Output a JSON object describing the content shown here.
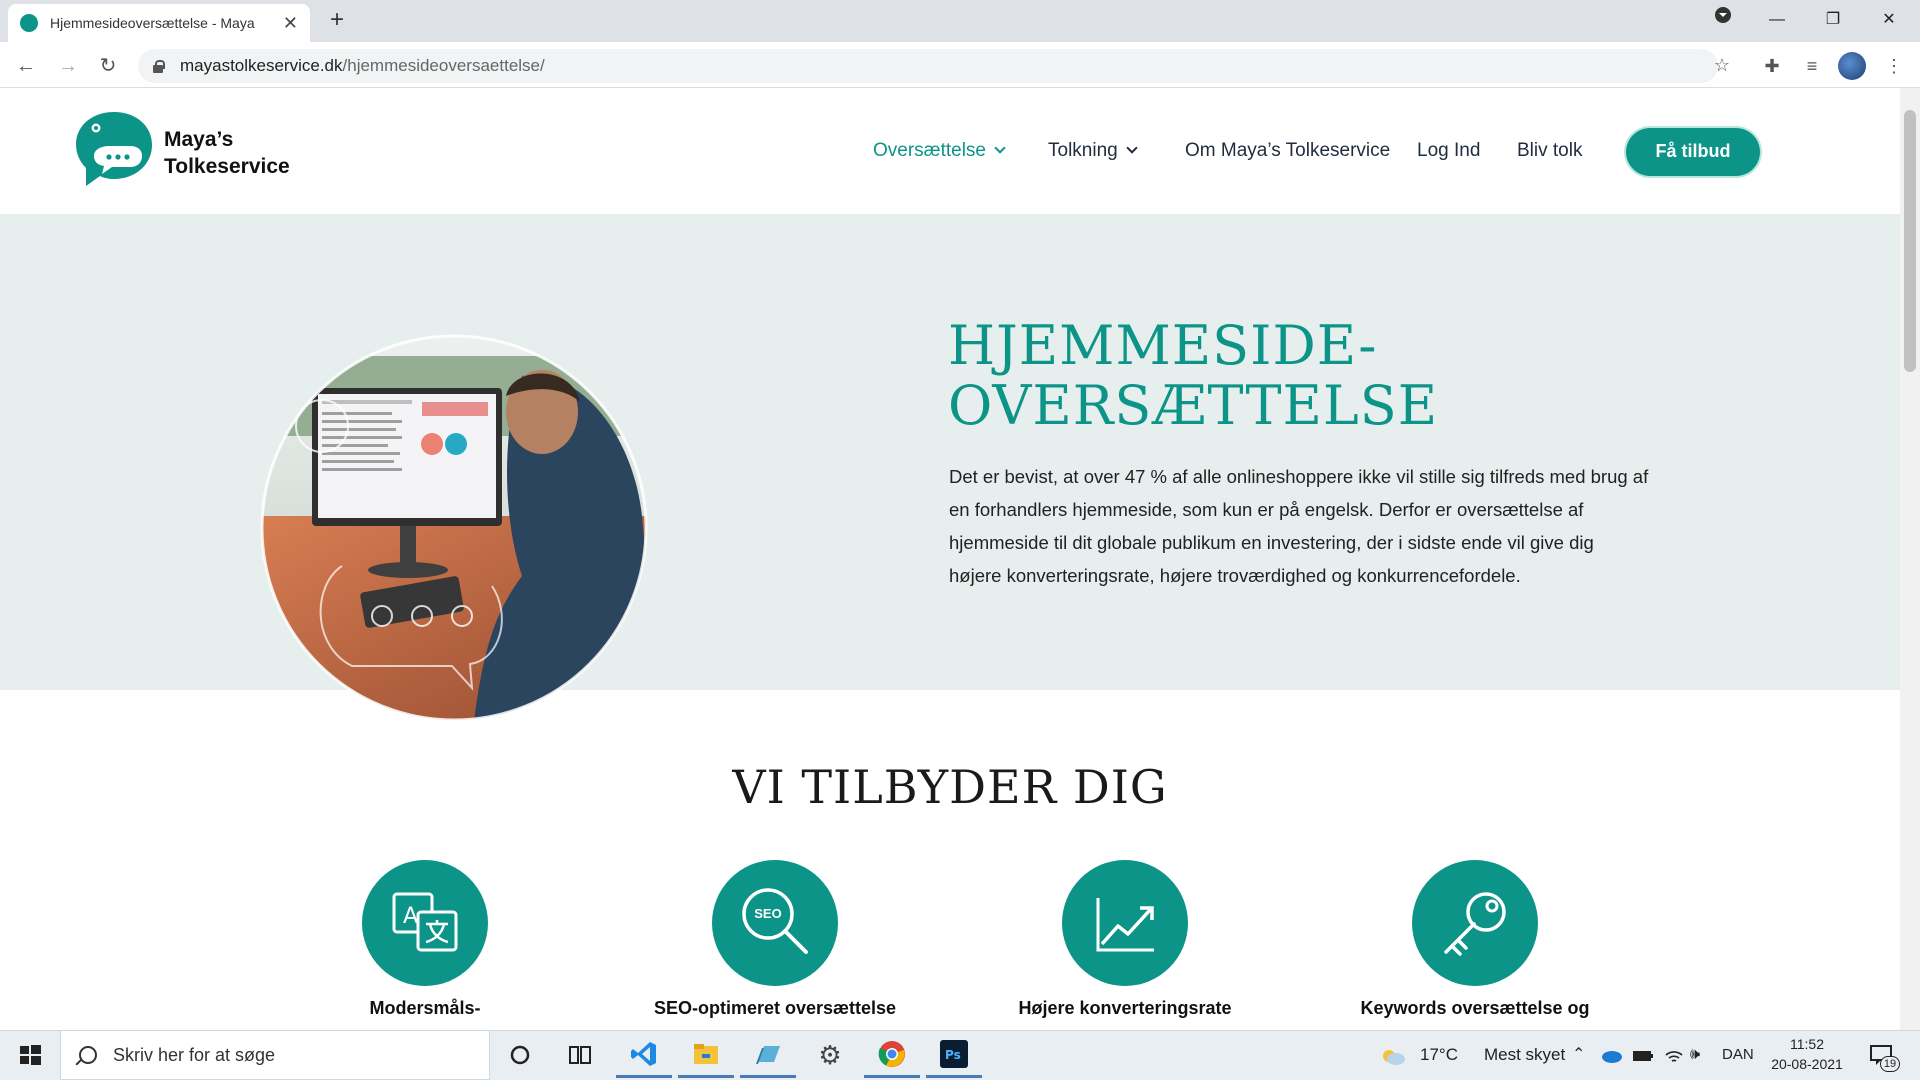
{
  "browser": {
    "tab_title": "Hjemmesideoversættelse - Maya",
    "new_tab_icon": "+",
    "url_host": "mayastolkeservice.dk",
    "url_path": "/hjemmesideoversaettelse/"
  },
  "site": {
    "logo_line1": "Maya’s",
    "logo_line2": "Tolkeservice",
    "nav": [
      {
        "label": "Oversættelse",
        "dropdown": true,
        "active": true
      },
      {
        "label": "Tolkning",
        "dropdown": true
      },
      {
        "label": "Om Maya’s Tolkeservice"
      },
      {
        "label": "Log Ind"
      },
      {
        "label": "Bliv tolk"
      }
    ],
    "cta_label": "Få tilbud",
    "accent_color": "#0d9488"
  },
  "hero": {
    "title_line1": "HJEMMESIDE-",
    "title_line2": "OVERSÆTTELSE",
    "text": "Det er bevist, at over 47 % af alle onlineshoppere ikke vil stille sig tilfreds med brug af en forhandlers hjemmeside, som kun er på engelsk. Derfor er oversættelse af hjemmeside til dit globale publikum en investering, der i sidste ende vil give dig højere konverteringsrate, højere troværdighed og konkurrencefordele."
  },
  "offers": {
    "title": "VI TILBYDER DIG",
    "items": [
      {
        "label": "Modersmåls-",
        "icon": "translate-icon"
      },
      {
        "label": "SEO-optimeret oversættelse",
        "icon": "seo-search-icon",
        "icon_text": "SEO"
      },
      {
        "label": "Højere konverteringsrate",
        "icon": "trend-up-icon"
      },
      {
        "label": "Keywords oversættelse og",
        "icon": "key-icon"
      }
    ]
  },
  "taskbar": {
    "search_placeholder": "Skriv her for at søge",
    "weather_temp": "17°C",
    "weather_desc": "Mest skyet",
    "language": "DAN",
    "time": "11:52",
    "date": "20-08-2021",
    "notification_count": "19"
  }
}
